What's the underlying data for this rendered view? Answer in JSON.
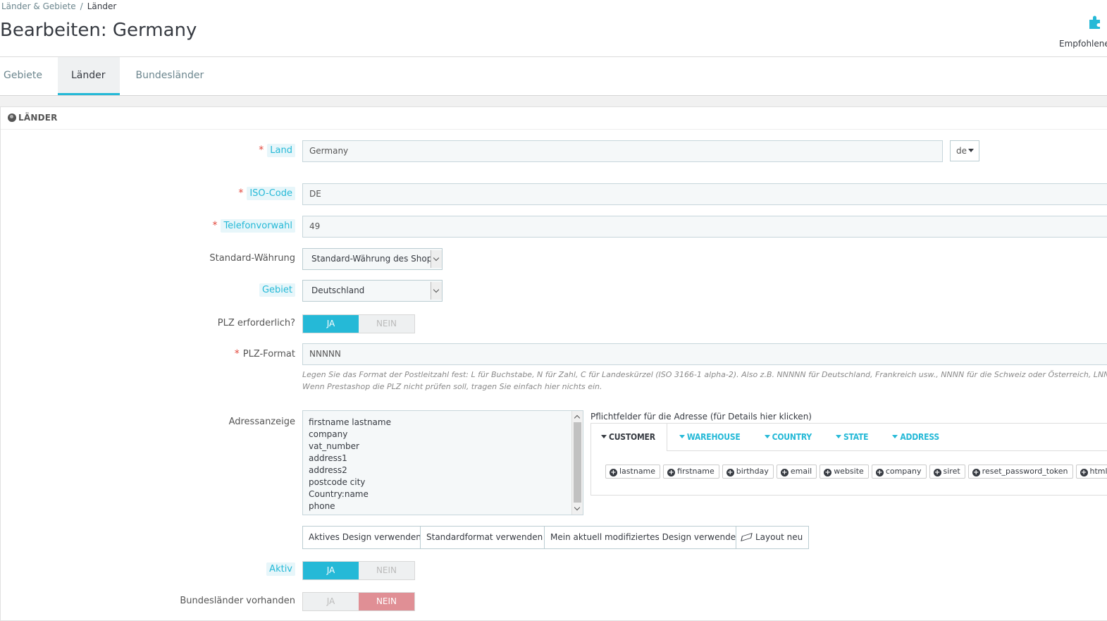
{
  "breadcrumb": {
    "parent": "Länder & Gebiete",
    "separator": "/",
    "current": "Länder"
  },
  "page": {
    "title": "Bearbeiten: Germany"
  },
  "toolbar": {
    "recommended_label": "Empfohlene",
    "recommended_icon": "puzzle-icon"
  },
  "tabs": [
    {
      "label": "Gebiete",
      "active": false
    },
    {
      "label": "Länder",
      "active": true
    },
    {
      "label": "Bundesländer",
      "active": false
    }
  ],
  "panel": {
    "title": "LÄNDER",
    "icon": "globe-icon"
  },
  "form": {
    "country": {
      "label": "Land",
      "value": "Germany",
      "lang": "de"
    },
    "iso": {
      "label": "ISO-Code",
      "value": "DE"
    },
    "phone": {
      "label": "Telefonvorwahl",
      "value": "49"
    },
    "currency": {
      "label": "Standard-Währung",
      "value": "Standard-Währung des Shops"
    },
    "zone": {
      "label": "Gebiet",
      "value": "Deutschland"
    },
    "zip_required": {
      "label": "PLZ erforderlich?",
      "yes": "JA",
      "no": "NEIN",
      "value": "JA"
    },
    "zip_format": {
      "label": "PLZ-Format",
      "value": "NNNNN",
      "help1": "Legen Sie das Format der Postleitzahl fest: L für Buchstabe, N für Zahl, C für Landeskürzel (ISO 3166-1 alpha-2). Also z.B. NNNNN für Deutschland, Frankreich usw., NNNN für die Schweiz oder Österreich, LNNNNLLL für",
      "help2": "Wenn Prestashop die PLZ nicht prüfen soll, tragen Sie einfach hier nichts ein."
    },
    "address_layout": {
      "label": "Adressanzeige",
      "lines": [
        "firstname lastname",
        "company",
        "vat_number",
        "address1",
        "address2",
        "postcode city",
        "Country:name",
        "phone"
      ]
    },
    "required_fields": {
      "title": "Pflichtfelder für die Adresse (für Details hier klicken)",
      "tabs": [
        "CUSTOMER",
        "WAREHOUSE",
        "COUNTRY",
        "STATE",
        "ADDRESS"
      ],
      "chips": [
        "lastname",
        "firstname",
        "birthday",
        "email",
        "website",
        "company",
        "siret",
        "reset_password_token",
        "htmlFields"
      ]
    },
    "buttons": {
      "active_design": "Aktives Design verwenden",
      "default_format": "Standardformat verwenden",
      "modified_design": "Mein aktuell modifiziertes Design verwenden",
      "reset_layout": "Layout neu"
    },
    "active": {
      "label": "Aktiv",
      "yes": "JA",
      "no": "NEIN",
      "value": "JA"
    },
    "states": {
      "label": "Bundesländer vorhanden",
      "yes": "JA",
      "no": "NEIN",
      "value": "NEIN"
    }
  },
  "colors": {
    "accent": "#25b9d7",
    "danger": "#e08f95",
    "required": "#e2473c"
  }
}
